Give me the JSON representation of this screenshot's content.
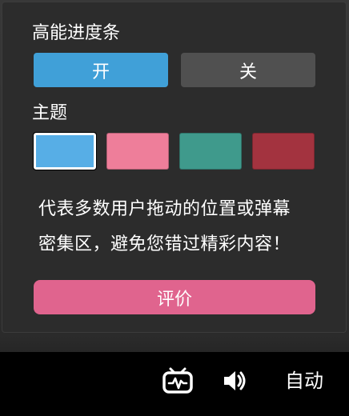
{
  "progress_section": {
    "title": "高能进度条",
    "on_label": "开",
    "off_label": "关",
    "on_color": "#40a0d8",
    "off_color": "#505050"
  },
  "theme_section": {
    "title": "主题",
    "swatches": [
      {
        "color": "#57aee6",
        "selected": true
      },
      {
        "color": "#ee7e9a",
        "selected": false
      },
      {
        "color": "#3f9a8c",
        "selected": false
      },
      {
        "color": "#a3333f",
        "selected": false
      }
    ]
  },
  "description": {
    "line1": "代表多数用户拖动的位置或弹幕",
    "line2": "密集区，避免您错过精彩内容！"
  },
  "rate_button": {
    "label": "评价",
    "color": "#e0648e"
  },
  "control_bar": {
    "icons": [
      "tv-icon",
      "volume-icon"
    ],
    "quality_label": "自动"
  }
}
